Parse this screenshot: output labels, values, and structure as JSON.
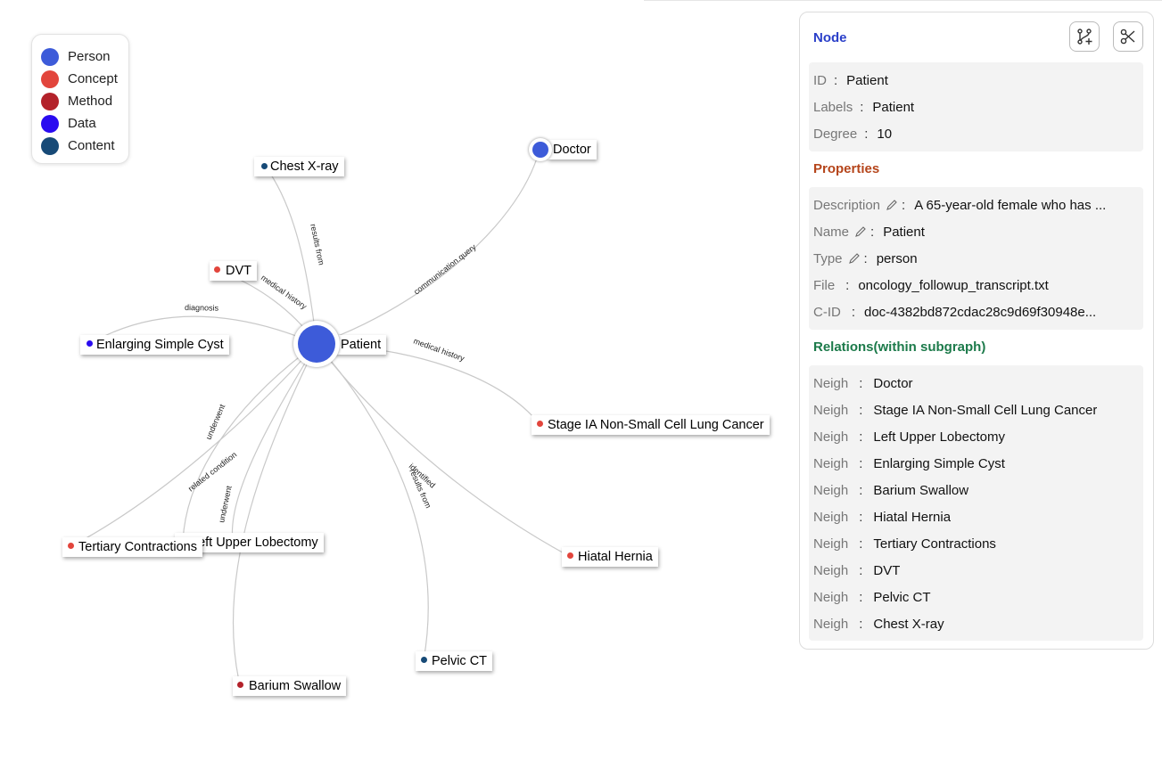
{
  "legend": {
    "items": [
      {
        "label": "Person",
        "color": "#3d5bd9"
      },
      {
        "label": "Concept",
        "color": "#e2453c"
      },
      {
        "label": "Method",
        "color": "#b3222a"
      },
      {
        "label": "Data",
        "color": "#2a0bf0"
      },
      {
        "label": "Content",
        "color": "#174a77"
      }
    ]
  },
  "graph": {
    "center": {
      "label": "Patient",
      "color": "#3d5bd9"
    },
    "doctor": {
      "label": "Doctor",
      "color": "#3d5bd9"
    },
    "nodes": {
      "chest_xray": {
        "label": "Chest X-ray",
        "color": "#174a77"
      },
      "dvt": {
        "label": "DVT",
        "color": "#e2453c"
      },
      "cyst": {
        "label": "Enlarging Simple Cyst",
        "color": "#2a0bf0"
      },
      "nsclc": {
        "label": "Stage IA Non-Small Cell Lung Cancer",
        "color": "#e2453c"
      },
      "tertiary": {
        "label": "Tertiary Contractions",
        "color": "#e2453c"
      },
      "lobectomy": {
        "label": "Left Upper Lobectomy",
        "color": "#b3222a"
      },
      "hernia": {
        "label": "Hiatal Hernia",
        "color": "#e2453c"
      },
      "pelvic_ct": {
        "label": "Pelvic CT",
        "color": "#174a77"
      },
      "barium": {
        "label": "Barium Swallow",
        "color": "#b3222a"
      }
    },
    "edges": {
      "results_from_1": "results from",
      "medical_history_1": "medical history",
      "communication_query": "communication.query",
      "diagnosis": "diagnosis",
      "medical_history_2": "medical history",
      "underwent_1": "underwent",
      "related_condition": "related condition",
      "underwent_2": "underwent",
      "identified": "identified",
      "results_from_2": "results from"
    }
  },
  "panel": {
    "node_title": "Node",
    "node_title_color": "#2a3fc9",
    "node_fields": [
      {
        "key": "ID",
        "value": "Patient"
      },
      {
        "key": "Labels",
        "value": "Patient"
      },
      {
        "key": "Degree",
        "value": "10"
      }
    ],
    "properties_title": "Properties",
    "properties_title_color": "#b5451b",
    "property_fields": [
      {
        "key": "Description",
        "value": "A 65-year-old female who has ..."
      },
      {
        "key": "Name",
        "value": "Patient"
      },
      {
        "key": "Type",
        "value": "person"
      },
      {
        "key": "File",
        "value": "oncology_followup_transcript.txt"
      },
      {
        "key": "C-ID",
        "value": "doc-4382bd872cdac28c9d69f30948e..."
      }
    ],
    "relations_title": "Relations(within subgraph)",
    "relations_title_color": "#1c7a4a",
    "relations": [
      {
        "key": "Neigh",
        "value": "Doctor"
      },
      {
        "key": "Neigh",
        "value": "Stage IA Non-Small Cell Lung Cancer"
      },
      {
        "key": "Neigh",
        "value": "Left Upper Lobectomy"
      },
      {
        "key": "Neigh",
        "value": "Enlarging Simple Cyst"
      },
      {
        "key": "Neigh",
        "value": "Barium Swallow"
      },
      {
        "key": "Neigh",
        "value": "Hiatal Hernia"
      },
      {
        "key": "Neigh",
        "value": "Tertiary Contractions"
      },
      {
        "key": "Neigh",
        "value": "DVT"
      },
      {
        "key": "Neigh",
        "value": "Pelvic CT"
      },
      {
        "key": "Neigh",
        "value": "Chest X-ray"
      }
    ],
    "sep": ":"
  },
  "icons": {
    "expand": "branch-plus-icon",
    "prune": "scissors-icon",
    "edit": "pencil-icon"
  }
}
